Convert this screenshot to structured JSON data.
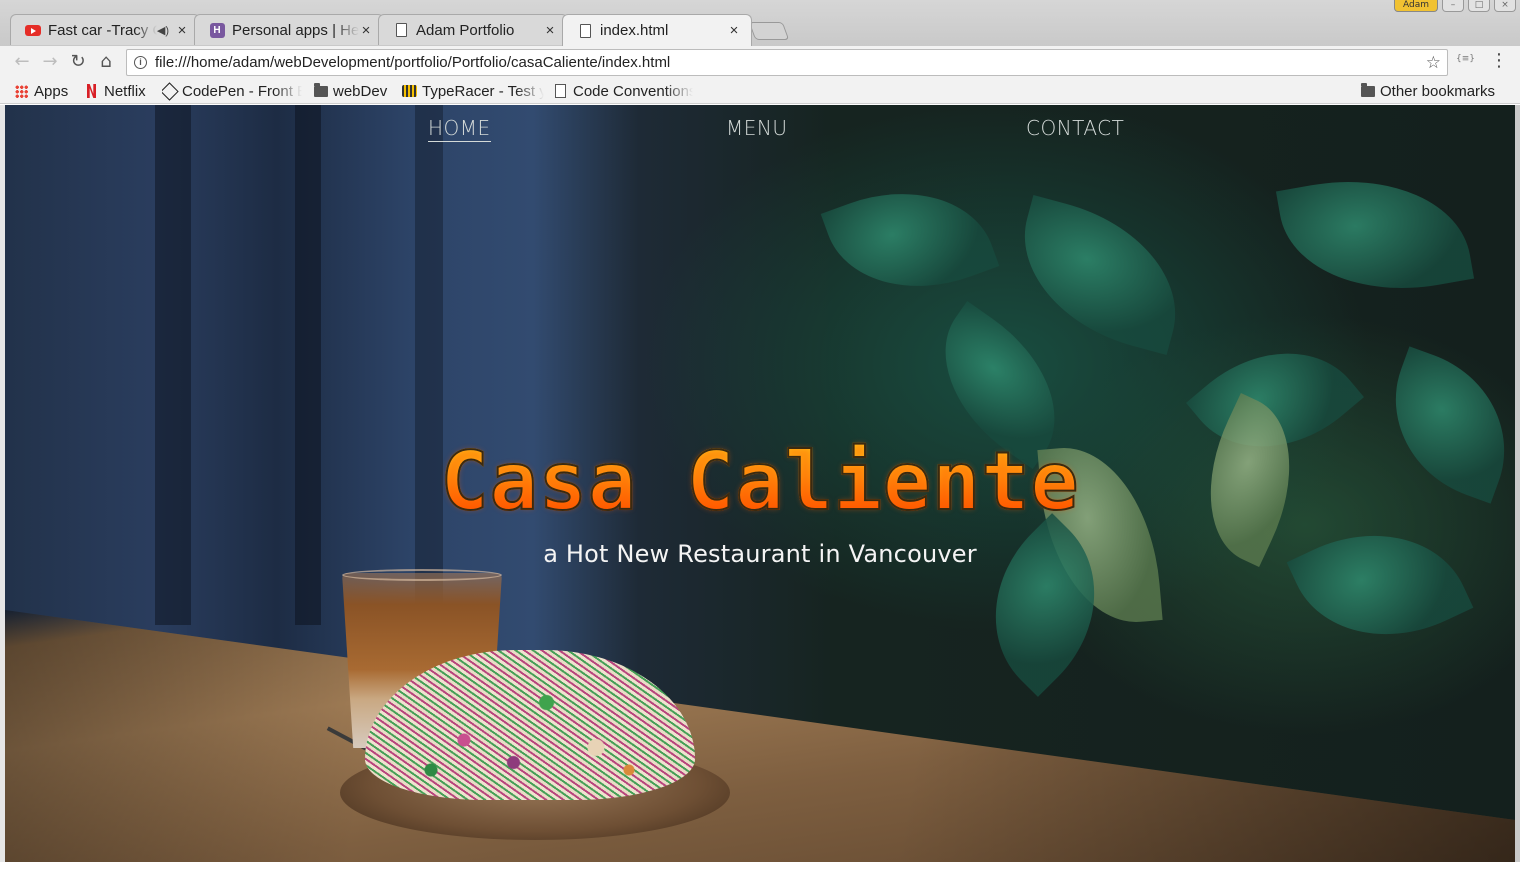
{
  "browser": {
    "window_controls": {
      "profile": "Adam"
    },
    "tabs": [
      {
        "title": "Fast car -Tracy Chapman",
        "favicon": "youtube-icon",
        "audio": true
      },
      {
        "title": "Personal apps | Heroku",
        "favicon": "heroku-icon",
        "audio": false
      },
      {
        "title": "Adam Portfolio",
        "favicon": "document-icon",
        "audio": false
      },
      {
        "title": "index.html",
        "favicon": "document-icon",
        "audio": false,
        "active": true
      }
    ],
    "url": "file:///home/adam/webDevelopment/portfolio/Portfolio/casaCaliente/index.html",
    "bookmarks": [
      {
        "label": "Apps",
        "icon": "apps-grid-icon"
      },
      {
        "label": "Netflix",
        "icon": "netflix-icon"
      },
      {
        "label": "CodePen - Front End Developer Playground",
        "icon": "codepen-icon"
      },
      {
        "label": "webDev",
        "icon": "folder-icon"
      },
      {
        "label": "TypeRacer - Test your typing speed",
        "icon": "typeracer-icon"
      },
      {
        "label": "Code Conventions",
        "icon": "document-icon"
      }
    ],
    "other_bookmarks": "Other bookmarks"
  },
  "page": {
    "nav": [
      {
        "label": "HOME",
        "active": true
      },
      {
        "label": "MENU",
        "active": false
      },
      {
        "label": "CONTACT",
        "active": false
      }
    ],
    "title": "Casa Caliente",
    "subtitle": "a Hot New Restaurant in Vancouver"
  },
  "colors": {
    "title_gradient_top": "#ffd21c",
    "title_gradient_bottom": "#ff3000",
    "nav_text": "#d4dad8"
  }
}
